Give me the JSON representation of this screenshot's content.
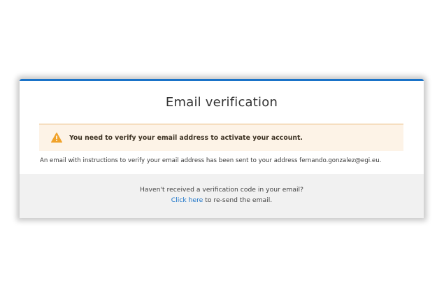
{
  "page": {
    "title": "Email verification"
  },
  "alert": {
    "icon": "warning-icon",
    "message": "You need to verify your email address to activate your account."
  },
  "info": {
    "text": "An email with instructions to verify your email address has been sent to your address fernando.gonzalez@egi.eu."
  },
  "footer": {
    "question": "Haven't received a verification code in your email?",
    "link_label": "Click here",
    "resend_suffix": " to re-send the email."
  },
  "colors": {
    "accent": "#1a73c8",
    "warning": "#f0a22b",
    "alert_background": "#fdf3e7"
  }
}
